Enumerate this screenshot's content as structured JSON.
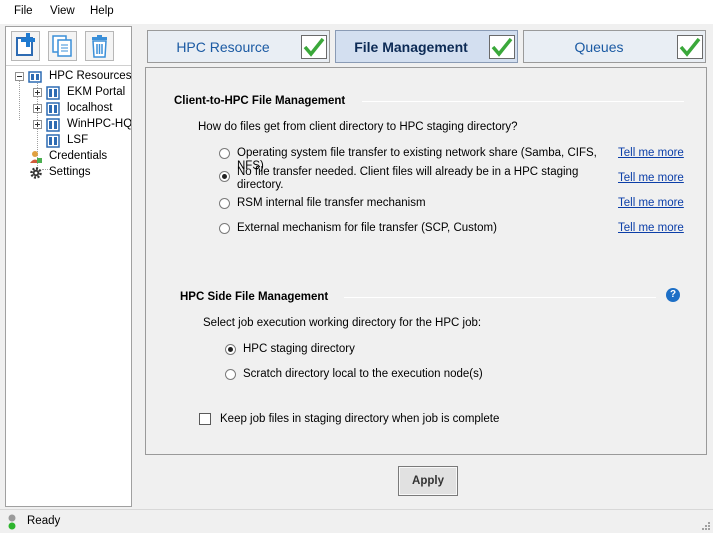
{
  "menu": {
    "file": "File",
    "view": "View",
    "help": "Help"
  },
  "tree": {
    "root": "HPC Resources",
    "resources": [
      "EKM Portal",
      "localhost",
      "WinHPC-HQ",
      "LSF"
    ],
    "credentials": "Credentials",
    "settings": "Settings"
  },
  "tabs": [
    {
      "label": "HPC Resource",
      "complete": true
    },
    {
      "label": "File Management",
      "complete": true,
      "active": true
    },
    {
      "label": "Queues",
      "complete": true
    }
  ],
  "client_section": {
    "title": "Client-to-HPC File Management",
    "question": "How do files get from client directory to HPC staging directory?",
    "options": [
      {
        "label": "Operating system file transfer to existing network share (Samba, CIFS, NFS)",
        "selected": false,
        "link": "Tell me more"
      },
      {
        "label": "No file transfer needed.  Client files will already be in a HPC staging directory.",
        "selected": true,
        "link": "Tell me more"
      },
      {
        "label": "RSM internal file transfer mechanism",
        "selected": false,
        "link": "Tell me more"
      },
      {
        "label": "External mechanism for file transfer (SCP, Custom)",
        "selected": false,
        "link": "Tell me more"
      }
    ]
  },
  "hpc_section": {
    "title": "HPC Side File Management",
    "question": "Select job execution working directory for the HPC job:",
    "options": [
      {
        "label": "HPC staging directory",
        "selected": true
      },
      {
        "label": "Scratch directory local to the execution node(s)",
        "selected": false
      }
    ],
    "keep_files_label": "Keep job files in staging directory when job is complete",
    "keep_files_checked": false
  },
  "apply_label": "Apply",
  "status": "Ready",
  "colors": {
    "check_green": "#3aa83a",
    "link_blue": "#0b3ea8",
    "tab_text": "#1b5aa3"
  }
}
